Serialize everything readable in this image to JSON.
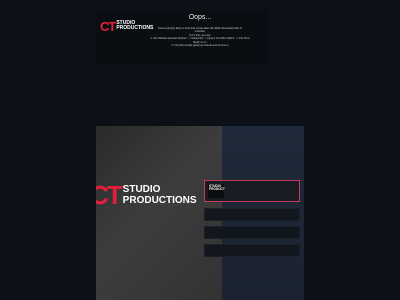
{
  "brand": {
    "logo_mark": "CT",
    "logo_line1": "STUDIO",
    "logo_line2": "PRODUCTIONS"
  },
  "error": {
    "title": "Oops...",
    "lines": [
      "Some query(s) likely to look that comes after the Slider Revolution files is",
      "included.",
      "To fix this, you can:",
      "1. Set 'Module General Options' -> 'Advanced' -> 'jQuery & OutPut Filters' -> 'Put JS to",
      "Body' to on",
      "2. Find the double jQuery.js include and remove it"
    ]
  },
  "preview": {
    "thumb_line1": "STUDIO",
    "thumb_line2": "PRODUCT"
  },
  "colors": {
    "brand_red": "#e2203a",
    "selected_border": "#c43a5c"
  }
}
